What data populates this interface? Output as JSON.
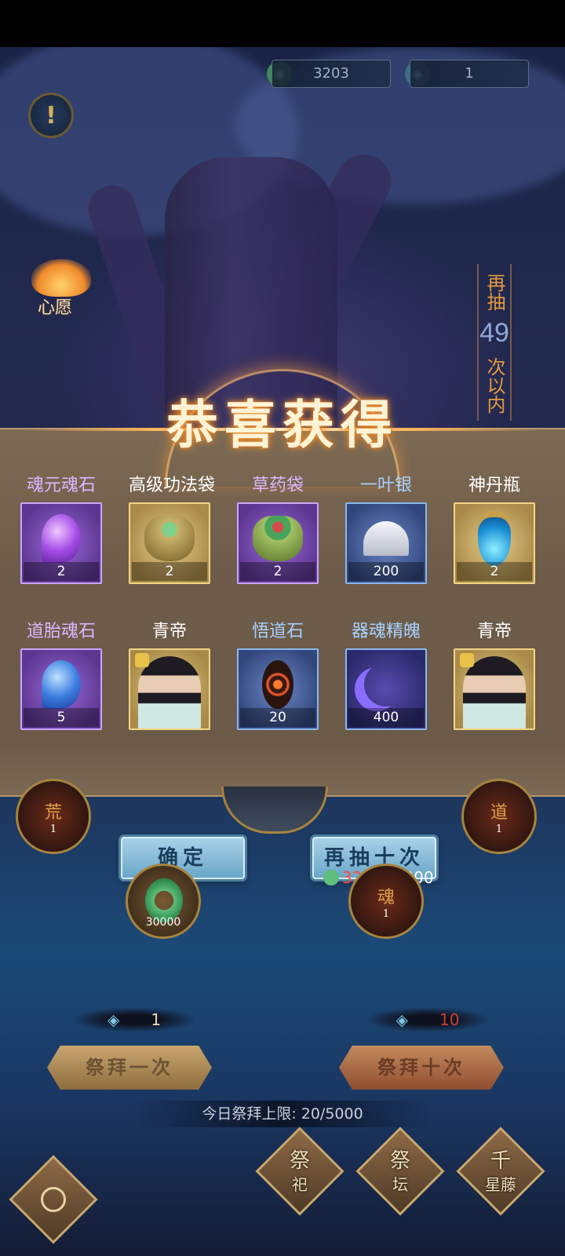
{
  "top_bar": {
    "jade_amount": "3203",
    "ticket_amount": "1"
  },
  "info_icon_glyph": "!",
  "wish": {
    "label": "心愿"
  },
  "side_counter": {
    "prefix": "再抽",
    "count": "49",
    "suffix": "次以内"
  },
  "reward_banner": {
    "title": "恭喜获得",
    "items": [
      {
        "name": "魂元魂石",
        "count": "2",
        "quality": "purple",
        "name_color": "#d9b8ff",
        "icon": "purple-soul-stone-icon"
      },
      {
        "name": "高级功法袋",
        "count": "2",
        "quality": "gold",
        "name_color": "#ffffff",
        "icon": "technique-bag-icon"
      },
      {
        "name": "草药袋",
        "count": "2",
        "quality": "purple",
        "name_color": "#d9b8ff",
        "icon": "herb-bag-icon"
      },
      {
        "name": "一叶银",
        "count": "200",
        "quality": "blue",
        "name_color": "#a8d0ff",
        "icon": "ginkgo-leaf-icon"
      },
      {
        "name": "神丹瓶",
        "count": "2",
        "quality": "gold",
        "name_color": "#ffffff",
        "icon": "elixir-bottle-icon"
      },
      {
        "name": "道胎魂石",
        "count": "5",
        "quality": "purple",
        "name_color": "#d9b8ff",
        "icon": "blue-soul-stone-icon"
      },
      {
        "name": "青帝",
        "count": "",
        "quality": "gold",
        "name_color": "#ffffff",
        "icon": "hero-portrait-icon"
      },
      {
        "name": "悟道石",
        "count": "20",
        "quality": "blue",
        "name_color": "#a8d0ff",
        "icon": "enlightenment-stone-icon"
      },
      {
        "name": "器魂精魄",
        "count": "400",
        "quality": "blue",
        "name_color": "#a8d0ff",
        "icon": "crescent-moon-icon"
      },
      {
        "name": "青帝",
        "count": "",
        "quality": "gold",
        "name_color": "#ffffff",
        "icon": "hero-portrait-icon"
      }
    ]
  },
  "heroes": {
    "left": {
      "char": "荒",
      "count": "1"
    },
    "right": {
      "char": "道",
      "count": "1"
    },
    "soul": {
      "char": "魂",
      "count": "1"
    }
  },
  "buttons": {
    "confirm": "确定",
    "draw_ten_again": "再抽十次"
  },
  "cost": {
    "current": "3203",
    "separator": "/",
    "required": "5000",
    "current_color": "#ff4a3a"
  },
  "jade_token": {
    "value": "30000"
  },
  "worship": {
    "once_tickets": "1",
    "ten_tickets": "10",
    "once_label": "祭拜一次",
    "ten_label": "祭拜十次",
    "daily_limit": "今日祭拜上限: 20/5000"
  },
  "bottom_nav": [
    {
      "main": "祭",
      "sub": "祀"
    },
    {
      "main": "祭",
      "sub": "坛"
    },
    {
      "main": "千",
      "sub": "星藤"
    }
  ]
}
